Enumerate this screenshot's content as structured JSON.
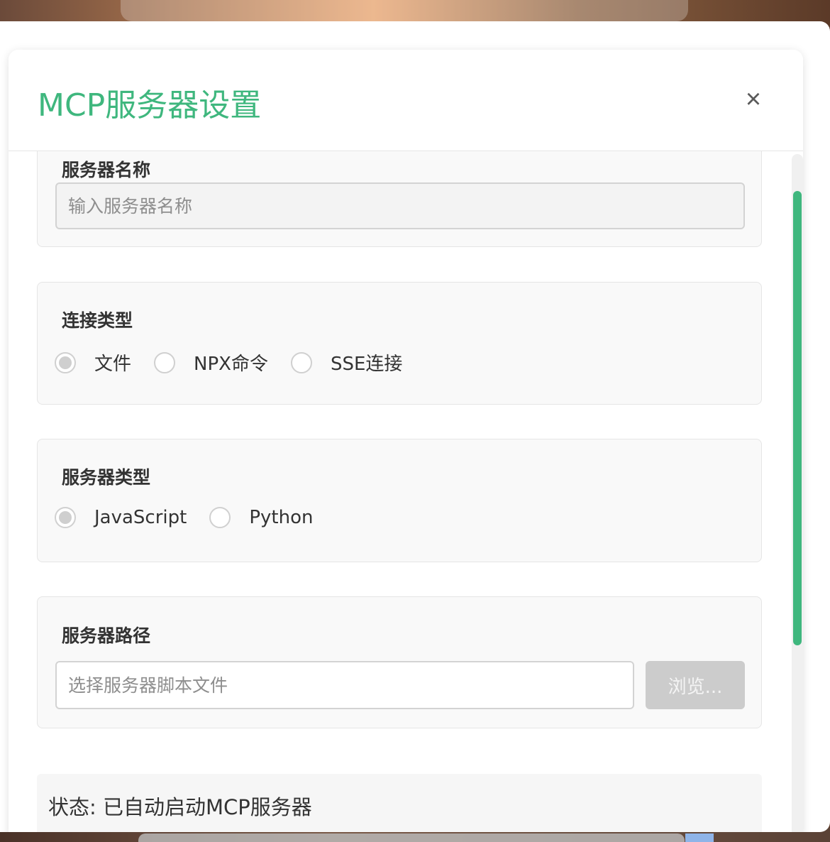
{
  "dialog": {
    "title": "MCP服务器设置",
    "close_icon": "×"
  },
  "server_name": {
    "label": "服务器名称",
    "placeholder": "输入服务器名称"
  },
  "connection_type": {
    "label": "连接类型",
    "options": [
      {
        "label": "文件",
        "checked": true
      },
      {
        "label": "NPX命令",
        "checked": false
      },
      {
        "label": "SSE连接",
        "checked": false
      }
    ]
  },
  "server_type": {
    "label": "服务器类型",
    "options": [
      {
        "label": "JavaScript",
        "checked": true
      },
      {
        "label": "Python",
        "checked": false
      }
    ]
  },
  "server_path": {
    "label": "服务器路径",
    "placeholder": "选择服务器脚本文件",
    "browse_label": "浏览..."
  },
  "status": {
    "text": "状态: 已自动启动MCP服务器"
  },
  "colors": {
    "accent": "#3fb77e",
    "radio_checked_fill": "#cfcfcf",
    "disabled_button": "#cccccc"
  }
}
